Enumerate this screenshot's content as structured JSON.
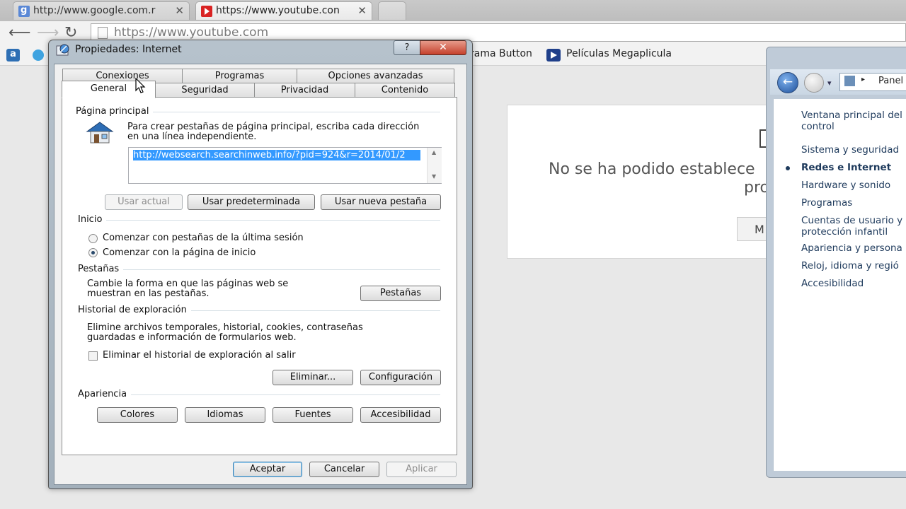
{
  "browser": {
    "tabs": [
      {
        "label": "http://www.google.com.r",
        "icon": "google-icon"
      },
      {
        "label": "https://www.youtube.con",
        "icon": "youtube-icon"
      }
    ],
    "address": "https://www.youtube.com",
    "bookmarks": [
      {
        "label": "rama Button"
      },
      {
        "label": "Películas Megaplicula"
      }
    ]
  },
  "page": {
    "error_line1": "No se ha podido establece",
    "error_line2": "pro",
    "error_button": "M"
  },
  "control_panel": {
    "breadcrumb": "Panel",
    "links": [
      "Ventana principal del",
      "control",
      "Sistema y seguridad",
      "Redes e Internet",
      "Hardware y sonido",
      "Programas",
      "Cuentas de usuario y",
      "protección infantil",
      "Apariencia y persona",
      "Reloj, idioma y regió",
      "Accesibilidad"
    ]
  },
  "dialog": {
    "title": "Propiedades: Internet",
    "help": "?",
    "close": "✕",
    "tabs_row1": [
      "Conexiones",
      "Programas",
      "Opciones avanzadas"
    ],
    "tabs_row2": [
      "General",
      "Seguridad",
      "Privacidad",
      "Contenido"
    ],
    "home": {
      "section": "Página principal",
      "desc1": "Para crear pestañas de página principal, escriba cada dirección",
      "desc2": "en una línea independiente.",
      "url": "http://websearch.searchinweb.info/?pid=924&r=2014/01/2",
      "btn_current": "Usar actual",
      "btn_default": "Usar predeterminada",
      "btn_newtab": "Usar nueva pestaña"
    },
    "startup": {
      "section": "Inicio",
      "opt1": "Comenzar con pestañas de la última sesión",
      "opt2": "Comenzar con la página de inicio"
    },
    "tabs_section": {
      "section": "Pestañas",
      "desc1": "Cambie la forma en que las páginas web se",
      "desc2": "muestran en las pestañas.",
      "button": "Pestañas"
    },
    "history": {
      "section": "Historial de exploración",
      "desc1": "Elimine archivos temporales, historial, cookies, contraseñas",
      "desc2": "guardadas e información de formularios web.",
      "checkbox": "Eliminar el historial de exploración al salir",
      "btn_delete": "Eliminar...",
      "btn_settings": "Configuración"
    },
    "appearance": {
      "section": "Apariencia",
      "buttons": [
        "Colores",
        "Idiomas",
        "Fuentes",
        "Accesibilidad"
      ]
    },
    "footer": {
      "ok": "Aceptar",
      "cancel": "Cancelar",
      "apply": "Aplicar"
    }
  }
}
